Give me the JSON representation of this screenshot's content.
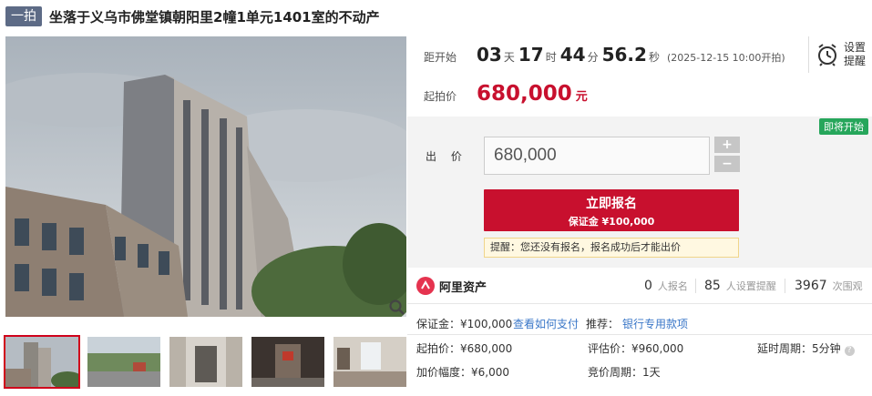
{
  "header": {
    "badge": "一拍",
    "title": "坐落于义乌市佛堂镇朝阳里2幢1单元1401室的不动产"
  },
  "gallery": {
    "thumbnails": [
      "building-exterior",
      "street-view",
      "corridor",
      "doorway",
      "living-room"
    ],
    "selected_index": 0
  },
  "countdown": {
    "label": "距开始",
    "days": "03",
    "days_unit": "天",
    "hours": "17",
    "hours_unit": "时",
    "minutes": "44",
    "minutes_unit": "分",
    "seconds": "56.2",
    "seconds_unit": "秒",
    "start_time": "(2025-12-15 10:00开拍)"
  },
  "reminder": {
    "label": "设置提醒"
  },
  "start_price": {
    "label": "起拍价",
    "value": "680,000",
    "unit": "元"
  },
  "status_badge": "即将开始",
  "bid": {
    "label": "出 价",
    "value": "680,000",
    "plus": "+",
    "minus": "−"
  },
  "signup": {
    "main": "立即报名",
    "sub": "保证金 ¥100,000"
  },
  "tip": "提醒：您还没有报名，报名成功后才能出价",
  "platform": "阿里资产",
  "stats": [
    {
      "num": "0",
      "label": "人报名"
    },
    {
      "num": "85",
      "label": "人设置提醒"
    },
    {
      "num": "3967",
      "label": "次围观"
    }
  ],
  "details": {
    "deposit": "保证金：¥100,000",
    "how_to_pay": "查看如何支付",
    "recommend_label": "推荐：",
    "recommend_link": "银行专用款项",
    "start_price": "起拍价：¥680,000",
    "appraisal": "评估价：¥960,000",
    "delay": "延时周期：5分钟",
    "increment": "加价幅度：¥6,000",
    "bid_period": "竞价周期：1天"
  },
  "colors": {
    "accent": "#c8102e",
    "badge_bg": "#5d6b86",
    "status_green": "#26a65b",
    "link": "#3a77c8"
  }
}
